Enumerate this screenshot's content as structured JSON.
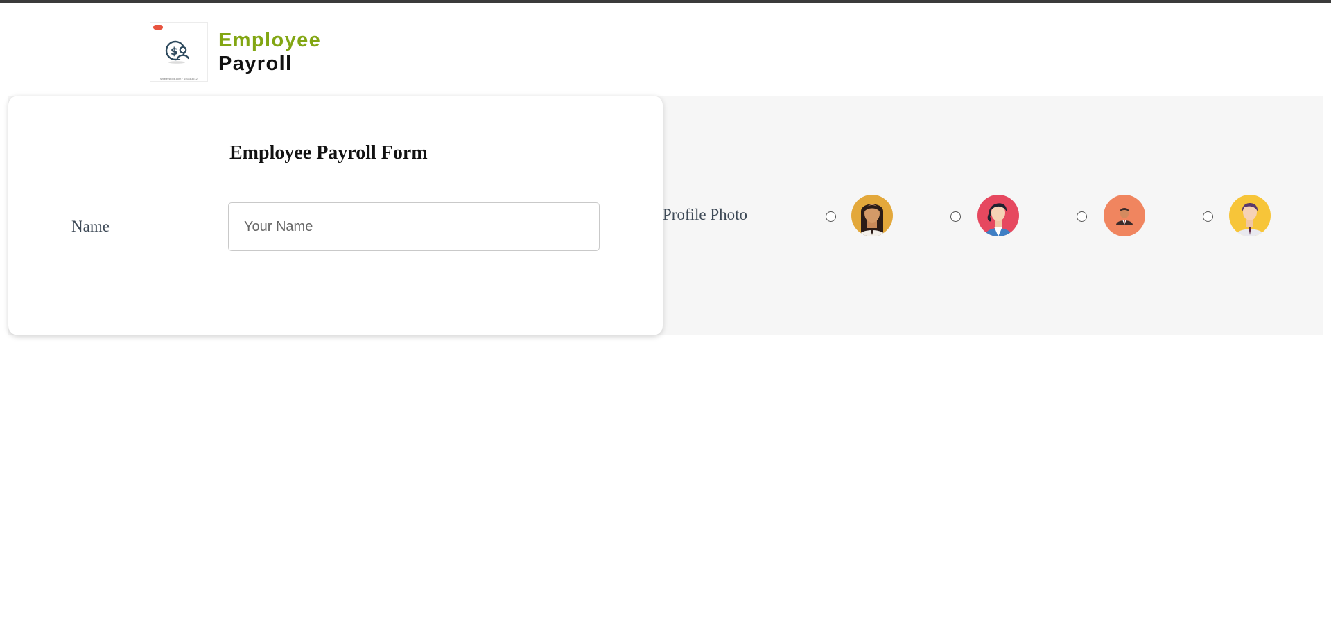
{
  "header": {
    "brand_line1": "Employee",
    "brand_line2": "Payroll",
    "logo_caption": "shutterstock.com · 446483512",
    "logo_icon": "payroll-dollar-person-icon",
    "colors": {
      "brand_accent": "#82a613",
      "brand_dark": "#111111"
    }
  },
  "form": {
    "title": "Employee Payroll Form",
    "name": {
      "label": "Name",
      "placeholder": "Your Name",
      "value": ""
    },
    "profile_photo": {
      "label": "Profile Photo",
      "options": [
        {
          "avatar": "woman-long-hair-avatar",
          "bg": "#e3a83b",
          "selected": false
        },
        {
          "avatar": "woman-curly-hair-avatar",
          "bg": "#e6485f",
          "selected": false
        },
        {
          "avatar": "man-suit-avatar",
          "bg": "#f0855f",
          "selected": false
        },
        {
          "avatar": "man-tie-avatar",
          "bg": "#f7c539",
          "selected": false
        }
      ]
    }
  },
  "colors": {
    "panel_bg": "#f6f6f6",
    "label_text": "#3e4a57"
  }
}
